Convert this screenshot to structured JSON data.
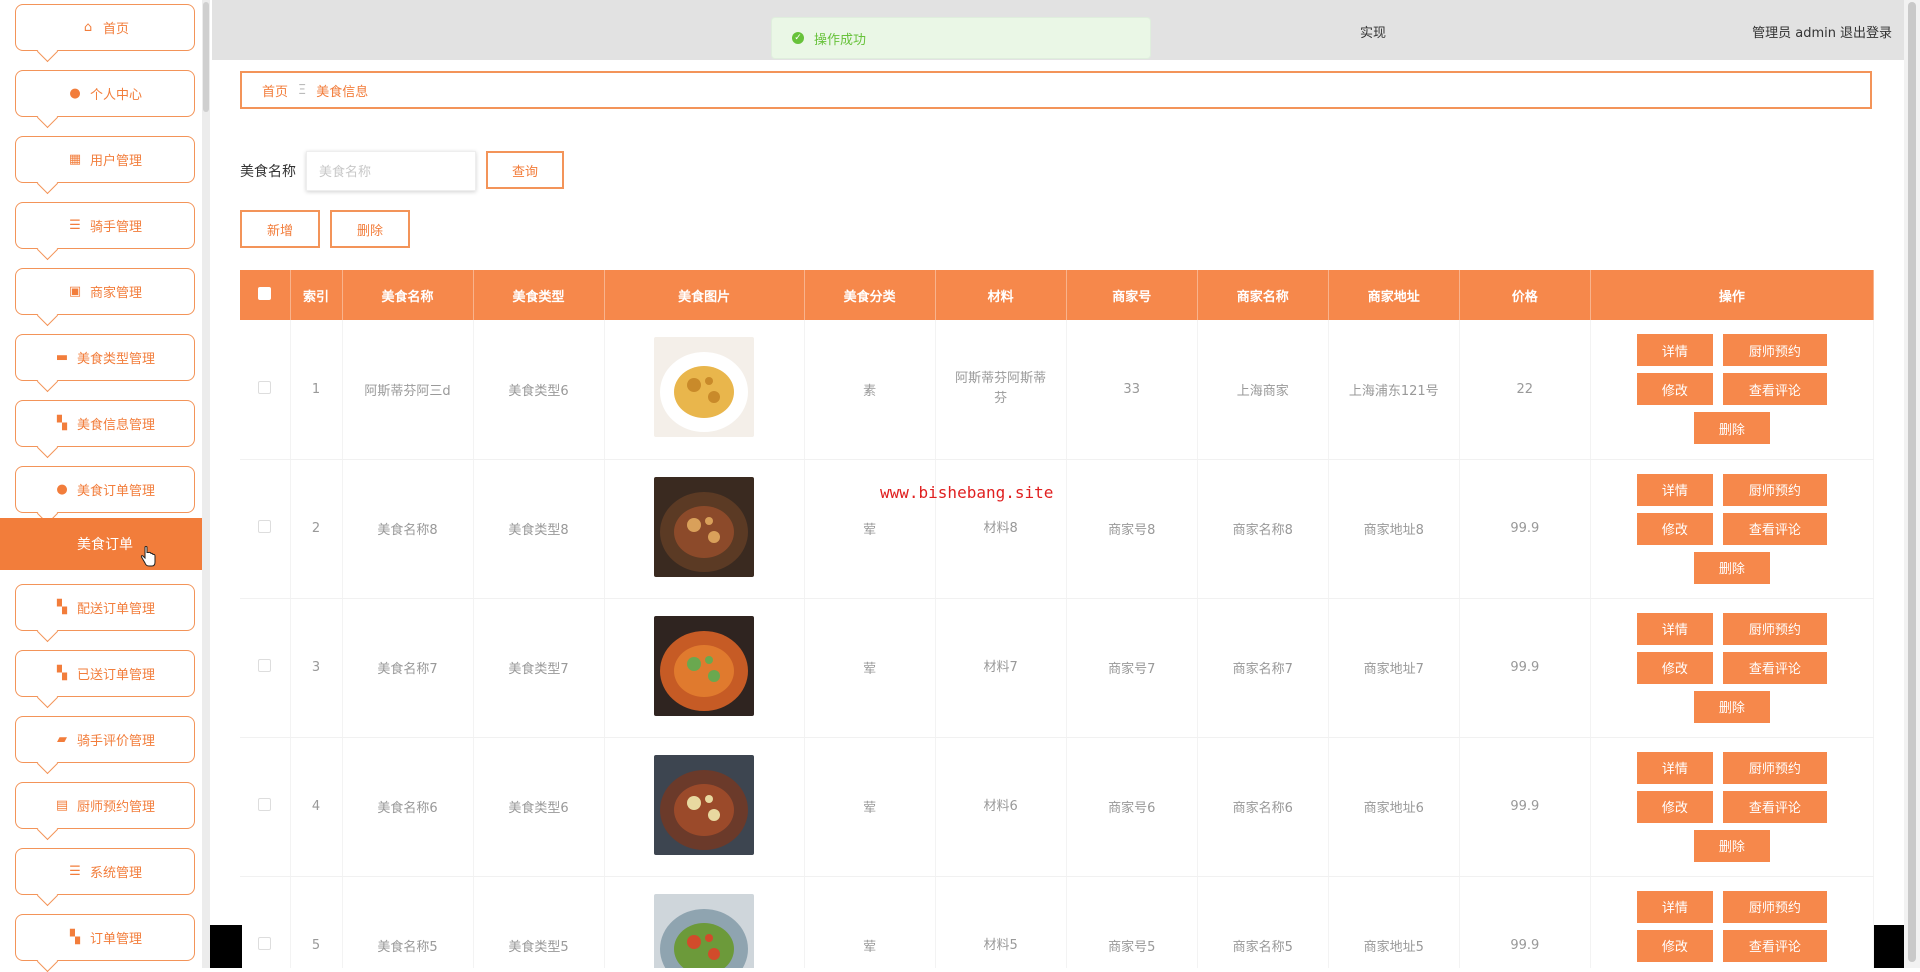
{
  "sidebar": {
    "items": [
      {
        "label": "首页",
        "icon": "home-icon",
        "glyph": "⌂"
      },
      {
        "label": "个人中心",
        "icon": "user-icon",
        "glyph": "●"
      },
      {
        "label": "用户管理",
        "icon": "grid-icon",
        "glyph": "▦"
      },
      {
        "label": "骑手管理",
        "icon": "list-icon",
        "glyph": "☰"
      },
      {
        "label": "商家管理",
        "icon": "shop-icon",
        "glyph": "▣"
      },
      {
        "label": "美食类型管理",
        "icon": "tag-icon",
        "glyph": "▬"
      },
      {
        "label": "美食信息管理",
        "icon": "apps-icon",
        "glyph": "▚"
      },
      {
        "label": "美食订单管理",
        "icon": "location-icon",
        "glyph": "●"
      },
      {
        "label": "配送订单管理",
        "icon": "apps-icon",
        "glyph": "▚"
      },
      {
        "label": "已送订单管理",
        "icon": "apps-icon",
        "glyph": "▚"
      },
      {
        "label": "骑手评价管理",
        "icon": "briefcase-icon",
        "glyph": "▰"
      },
      {
        "label": "厨师预约管理",
        "icon": "clipboard-icon",
        "glyph": "▤"
      },
      {
        "label": "系统管理",
        "icon": "settings-icon",
        "glyph": "☰"
      },
      {
        "label": "订单管理",
        "icon": "apps-icon",
        "glyph": "▚"
      }
    ],
    "active_submenu": "美食订单"
  },
  "header": {
    "title_fragment": "实现",
    "user": "管理员 admin",
    "logout": "退出登录"
  },
  "toast": {
    "message": "操作成功"
  },
  "breadcrumb": {
    "home": "首页",
    "separator": "Ξ",
    "current": "美食信息"
  },
  "search": {
    "label": "美食名称",
    "placeholder": "美食名称",
    "button": "查询"
  },
  "toolbar": {
    "add": "新增",
    "delete": "删除"
  },
  "table": {
    "headers": [
      "索引",
      "美食名称",
      "美食类型",
      "美食图片",
      "美食分类",
      "材料",
      "商家号",
      "商家名称",
      "商家地址",
      "价格",
      "操作"
    ],
    "rows": [
      {
        "index": "1",
        "name": "阿斯蒂芬阿三d",
        "type": "美食类型6",
        "category": "素",
        "material": "阿斯蒂芬阿斯蒂芬",
        "shop_no": "33",
        "shop_name": "上海商家",
        "address": "上海浦东121号",
        "price": "22"
      },
      {
        "index": "2",
        "name": "美食名称8",
        "type": "美食类型8",
        "category": "荤",
        "material": "材料8",
        "shop_no": "商家号8",
        "shop_name": "商家名称8",
        "address": "商家地址8",
        "price": "99.9"
      },
      {
        "index": "3",
        "name": "美食名称7",
        "type": "美食类型7",
        "category": "荤",
        "material": "材料7",
        "shop_no": "商家号7",
        "shop_name": "商家名称7",
        "address": "商家地址7",
        "price": "99.9"
      },
      {
        "index": "4",
        "name": "美食名称6",
        "type": "美食类型6",
        "category": "荤",
        "material": "材料6",
        "shop_no": "商家号6",
        "shop_name": "商家名称6",
        "address": "商家地址6",
        "price": "99.9"
      },
      {
        "index": "5",
        "name": "美食名称5",
        "type": "美食类型5",
        "category": "荤",
        "material": "材料5",
        "shop_no": "商家号5",
        "shop_name": "商家名称5",
        "address": "商家地址5",
        "price": "99.9"
      }
    ],
    "actions": {
      "detail": "详情",
      "chef": "厨师预约",
      "edit": "修改",
      "comments": "查看评论",
      "delete": "删除"
    }
  },
  "watermark": "www.bishebang.site",
  "colors": {
    "accent": "#f27d3b",
    "header_bg": "#f6884b",
    "success": "#67c23a",
    "watermark": "#e02020"
  }
}
